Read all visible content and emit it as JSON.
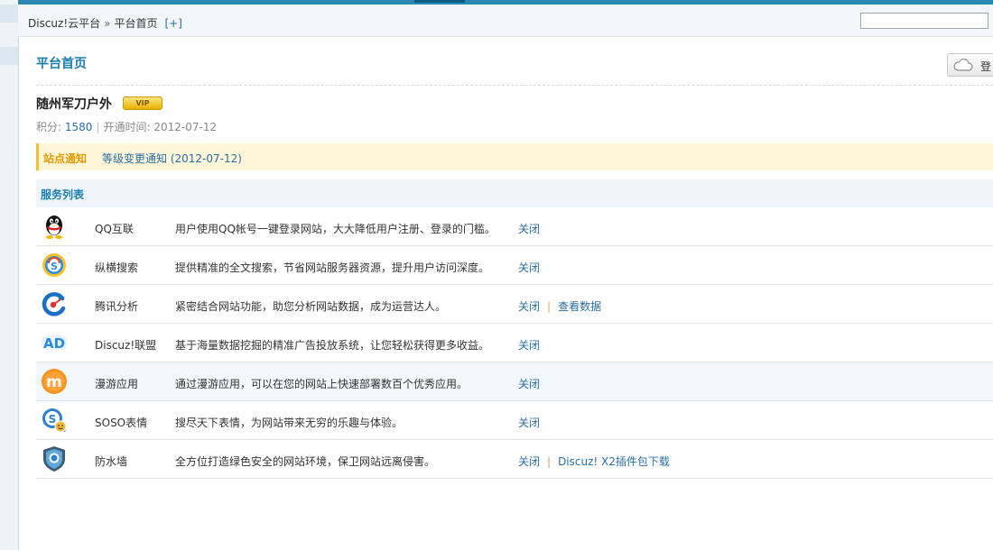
{
  "nav": {
    "breadcrumb_root": "Discuz!云平台",
    "breadcrumb_sep": "»",
    "breadcrumb_current": "平台首页",
    "add_label": "[+]",
    "search_value": ""
  },
  "main": {
    "title": "平台首页",
    "cloud_button_label": "登",
    "site_name": "随州军刀户外",
    "badge_text": "VIP",
    "score_label": "积分:",
    "score_value": "1580",
    "open_label": "开通时间:",
    "open_date": "2012-07-12",
    "notice_label": "站点通知",
    "notice_text": "等级变更通知 (2012-07-12)",
    "services_header": "服务列表"
  },
  "services": [
    {
      "name": "QQ互联",
      "desc": "用户使用QQ帐号一键登录网站，大大降低用户注册、登录的门槛。",
      "action1": "关闭",
      "action2": "",
      "icon": "qq-penguin-icon"
    },
    {
      "name": "纵横搜索",
      "desc": "提供精准的全文搜索，节省网站服务器资源，提升用户访问深度。",
      "action1": "关闭",
      "action2": "",
      "icon": "soso-search-icon"
    },
    {
      "name": "腾讯分析",
      "desc": "紧密结合网站功能，助您分析网站数据，成为运营达人。",
      "action1": "关闭",
      "action2": "查看数据",
      "icon": "analytics-icon"
    },
    {
      "name": "Discuz!联盟",
      "desc": "基于海量数据挖掘的精准广告投放系统，让您轻松获得更多收益。",
      "action1": "关闭",
      "action2": "",
      "icon": "ad-union-icon"
    },
    {
      "name": "漫游应用",
      "desc": "通过漫游应用，可以在您的网站上快速部署数百个优秀应用。",
      "action1": "关闭",
      "action2": "",
      "icon": "manyou-icon"
    },
    {
      "name": "SOSO表情",
      "desc": "搜尽天下表情，为网站带来无穷的乐趣与体验。",
      "action1": "关闭",
      "action2": "",
      "icon": "soso-emoticon-icon"
    },
    {
      "name": "防水墙",
      "desc": "全方位打造绿色安全的网站环境，保卫网站远离侵害。",
      "action1": "关闭",
      "action2": "Discuz! X2插件包下载",
      "icon": "security-shield-icon"
    }
  ],
  "colors": {
    "accent": "#1a7fb0",
    "link": "#2b6ea3",
    "notice_bg": "#fdf6d9",
    "notice_label": "#e69a00"
  }
}
